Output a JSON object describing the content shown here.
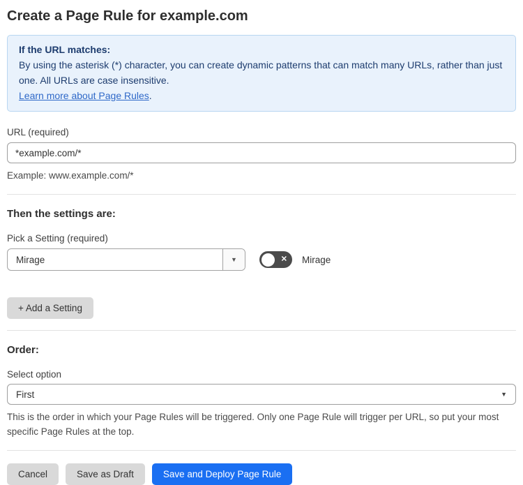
{
  "page": {
    "title": "Create a Page Rule for example.com"
  },
  "info_box": {
    "heading": "If the URL matches:",
    "body": "By using the asterisk (*) character, you can create dynamic patterns that can match many URLs, rather than just one. All URLs are case insensitive.",
    "link_label": "Learn more about Page Rules",
    "link_suffix": "."
  },
  "url_field": {
    "label": "URL (required)",
    "value": "*example.com/*",
    "helper": "Example: www.example.com/*"
  },
  "settings_section": {
    "heading": "Then the settings are:",
    "picker_label": "Pick a Setting (required)",
    "picker_value": "Mirage",
    "toggle_label": "Mirage",
    "toggle_state": "off",
    "add_button_label": "+ Add a Setting"
  },
  "order_section": {
    "heading": "Order:",
    "select_label": "Select option",
    "select_value": "First",
    "helper": "This is the order in which your Page Rules will be triggered. Only one Page Rule will trigger per URL, so put your most specific Page Rules at the top."
  },
  "footer": {
    "cancel_label": "Cancel",
    "save_draft_label": "Save as Draft",
    "save_deploy_label": "Save and Deploy Page Rule"
  },
  "icons": {
    "caret_down": "▼",
    "toggle_x": "✕"
  },
  "colors": {
    "info_bg": "#e9f2fc",
    "info_border": "#b8d6f1",
    "info_text": "#1d3c6e",
    "link": "#2e68c8",
    "primary_button": "#1a6ff2",
    "gray_button": "#d9d9d9",
    "toggle_off": "#4b4b4b"
  }
}
